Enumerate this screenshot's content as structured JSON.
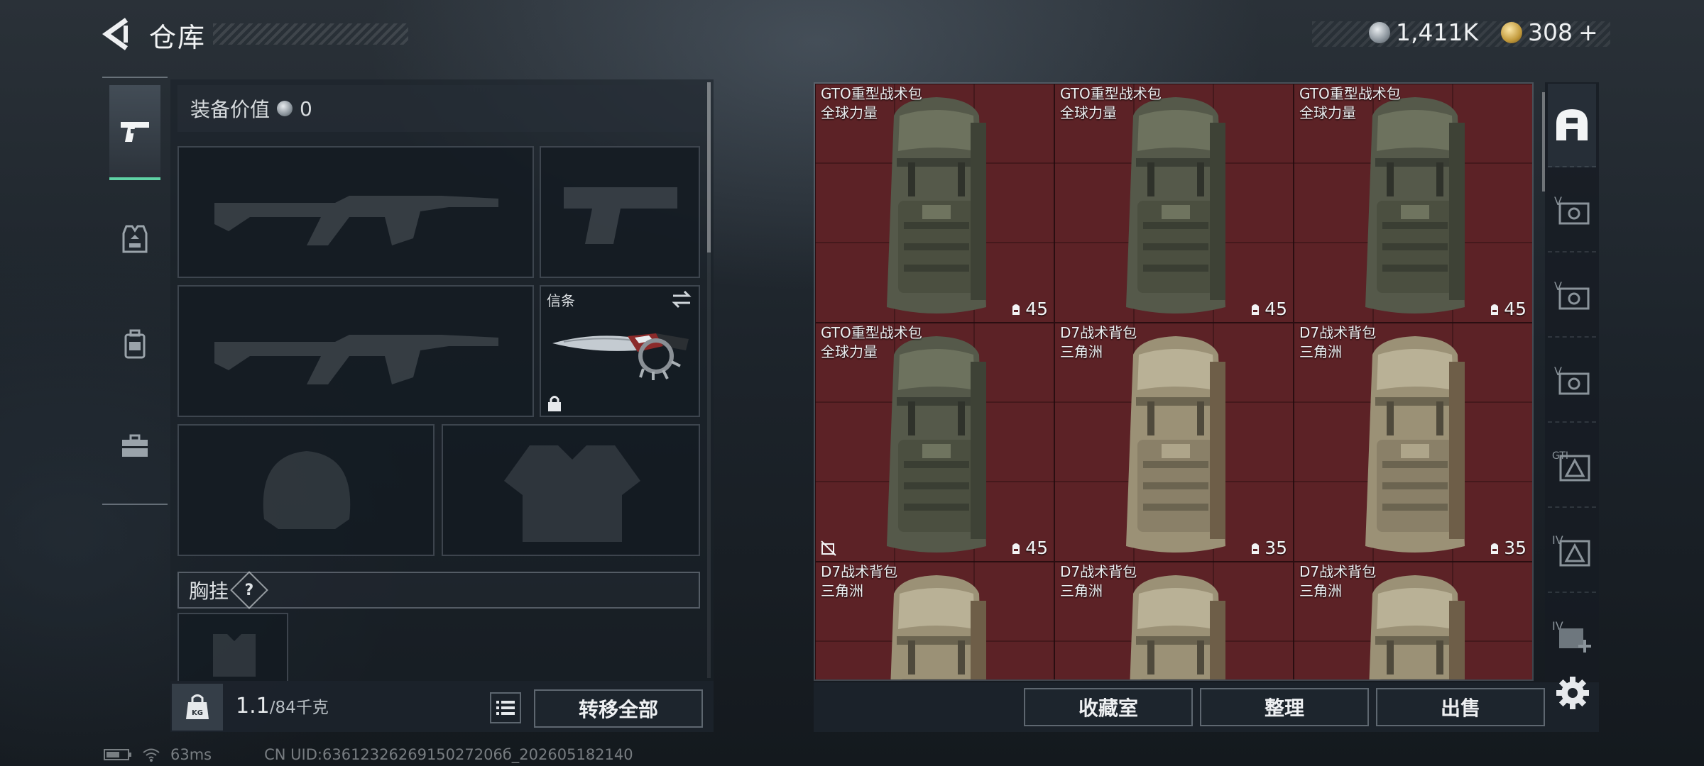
{
  "header": {
    "title": "仓库",
    "currency_silver": "1,411K",
    "currency_gold": "308",
    "currency_gold_plus": "+"
  },
  "left_tabs": [
    {
      "name": "weapons",
      "icon": "pistol-icon",
      "active": true
    },
    {
      "name": "gear",
      "icon": "vest-icon",
      "active": false
    },
    {
      "name": "backpack",
      "icon": "backpack-icon",
      "active": false
    },
    {
      "name": "case",
      "icon": "briefcase-icon",
      "active": false
    }
  ],
  "equipment": {
    "value_label": "装备价值",
    "value_amount": "0",
    "melee_label": "信条",
    "chest_rig_label": "胸挂",
    "chest_rig_help": "?"
  },
  "weight": {
    "current": "1.1",
    "max": "/84千克",
    "icon_text": "KG"
  },
  "transfer_all": "转移全部",
  "grid_items": [
    {
      "name": "GTO重型战术包",
      "sub": "全球力量",
      "capacity": "45",
      "style": "green",
      "locked": false
    },
    {
      "name": "GTO重型战术包",
      "sub": "全球力量",
      "capacity": "45",
      "style": "green",
      "locked": false
    },
    {
      "name": "GTO重型战术包",
      "sub": "全球力量",
      "capacity": "45",
      "style": "green",
      "locked": false
    },
    {
      "name": "GTO重型战术包",
      "sub": "全球力量",
      "capacity": "45",
      "style": "green",
      "locked": true
    },
    {
      "name": "D7战术背包",
      "sub": "三角洲",
      "capacity": "35",
      "style": "tan",
      "locked": false
    },
    {
      "name": "D7战术背包",
      "sub": "三角洲",
      "capacity": "35",
      "style": "tan",
      "locked": false
    },
    {
      "name": "D7战术背包",
      "sub": "三角洲",
      "capacity": "",
      "style": "tan",
      "locked": false
    },
    {
      "name": "D7战术背包",
      "sub": "三角洲",
      "capacity": "",
      "style": "tan",
      "locked": false
    },
    {
      "name": "D7战术背包",
      "sub": "三角洲",
      "capacity": "",
      "style": "tan",
      "locked": false
    }
  ],
  "actions": {
    "collection": "收藏室",
    "sort": "整理",
    "sell": "出售"
  },
  "right_tabs": [
    {
      "icon": "helmet-icon",
      "active": true
    },
    {
      "icon": "level-v-safe-icon-1",
      "active": false
    },
    {
      "icon": "level-v-safe-icon-2",
      "active": false
    },
    {
      "icon": "level-v-safe-icon-3",
      "active": false
    },
    {
      "icon": "gti-warning-icon",
      "active": false
    },
    {
      "icon": "level-iv-warning-icon",
      "active": false
    },
    {
      "icon": "level-iv-add-icon",
      "active": false
    }
  ],
  "status_bar": {
    "ping": "63ms",
    "uid": "CN UID:6361232626915027206б_202605182140"
  },
  "colors": {
    "accent": "#5fd3a5",
    "cell_bg": "#5c2226"
  }
}
